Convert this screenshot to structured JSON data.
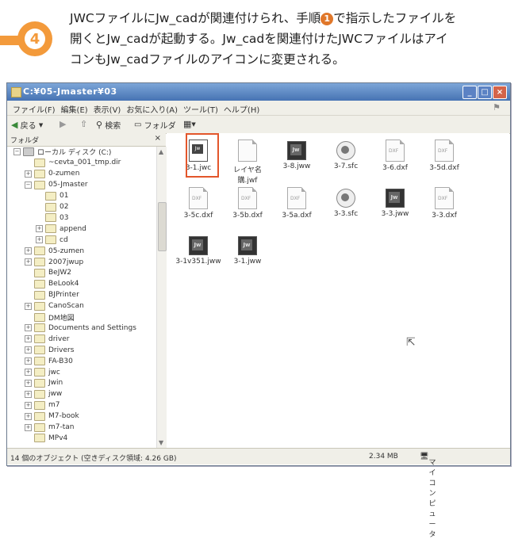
{
  "step": {
    "number": "4"
  },
  "caption": {
    "line1_a": "JWCファイルにJw_cadが関連付けられ、手順",
    "circled": "1",
    "line1_b": "で指示したファイルを",
    "line2": "開くとJw_cadが起動する。Jw_cadを関連付けたJWCファイルはアイ",
    "line3": "コンもJw_cadファイルのアイコンに変更される。"
  },
  "window": {
    "title": "C:¥05-Jmaster¥03",
    "menu": [
      "ファイル(F)",
      "編集(E)",
      "表示(V)",
      "お気に入り(A)",
      "ツール(T)",
      "ヘルプ(H)"
    ],
    "toolbar": {
      "back": "戻る",
      "search": "検索",
      "folders": "フォルダ"
    },
    "folder_pane_title": "フォルダ",
    "tree": [
      {
        "label": "ローカル ディスク (C:)",
        "indent": 0,
        "pm": "−"
      },
      {
        "label": "~cevta_001_tmp.dir",
        "indent": 1,
        "pm": ""
      },
      {
        "label": "0-zumen",
        "indent": 1,
        "pm": "+"
      },
      {
        "label": "05-Jmaster",
        "indent": 1,
        "pm": "−"
      },
      {
        "label": "01",
        "indent": 2,
        "pm": ""
      },
      {
        "label": "02",
        "indent": 2,
        "pm": ""
      },
      {
        "label": "03",
        "indent": 2,
        "pm": ""
      },
      {
        "label": "append",
        "indent": 2,
        "pm": "+"
      },
      {
        "label": "cd",
        "indent": 2,
        "pm": "+"
      },
      {
        "label": "05-zumen",
        "indent": 1,
        "pm": "+"
      },
      {
        "label": "2007jwup",
        "indent": 1,
        "pm": "+"
      },
      {
        "label": "BeJW2",
        "indent": 1,
        "pm": ""
      },
      {
        "label": "BeLook4",
        "indent": 1,
        "pm": ""
      },
      {
        "label": "BJPrinter",
        "indent": 1,
        "pm": ""
      },
      {
        "label": "CanoScan",
        "indent": 1,
        "pm": "+"
      },
      {
        "label": "DM地図",
        "indent": 1,
        "pm": ""
      },
      {
        "label": "Documents and Settings",
        "indent": 1,
        "pm": "+"
      },
      {
        "label": "driver",
        "indent": 1,
        "pm": "+"
      },
      {
        "label": "Drivers",
        "indent": 1,
        "pm": "+"
      },
      {
        "label": "FA-B30",
        "indent": 1,
        "pm": "+"
      },
      {
        "label": "jwc",
        "indent": 1,
        "pm": "+"
      },
      {
        "label": "Jwin",
        "indent": 1,
        "pm": "+"
      },
      {
        "label": "jww",
        "indent": 1,
        "pm": "+"
      },
      {
        "label": "m7",
        "indent": 1,
        "pm": "+"
      },
      {
        "label": "M7-book",
        "indent": 1,
        "pm": "+"
      },
      {
        "label": "m7-tan",
        "indent": 1,
        "pm": "+"
      },
      {
        "label": "MPv4",
        "indent": 1,
        "pm": ""
      }
    ],
    "files": [
      {
        "name": "3-1.jwc",
        "type": "jwc"
      },
      {
        "name": "レイヤ名購.jwf",
        "type": "doc",
        "lbl": ""
      },
      {
        "name": "3-8.jww",
        "type": "jw"
      },
      {
        "name": "3-7.sfc",
        "type": "sfc"
      },
      {
        "name": "3-6.dxf",
        "type": "doc",
        "lbl": "DXF"
      },
      {
        "name": "3-5d.dxf",
        "type": "doc",
        "lbl": "DXF"
      },
      {
        "name": "3-5c.dxf",
        "type": "doc",
        "lbl": "DXF"
      },
      {
        "name": "3-5b.dxf",
        "type": "doc",
        "lbl": "DXF"
      },
      {
        "name": "3-5a.dxf",
        "type": "doc",
        "lbl": "DXF"
      },
      {
        "name": "3-3.sfc",
        "type": "sfc"
      },
      {
        "name": "3-3.jww",
        "type": "jw"
      },
      {
        "name": "3-3.dxf",
        "type": "doc",
        "lbl": "DXF"
      },
      {
        "name": "3-1v351.jww",
        "type": "jw"
      },
      {
        "name": "3-1.jww",
        "type": "jw"
      }
    ],
    "status": {
      "objects": "14 個のオブジェクト (空きディスク領域: 4.26 GB)",
      "size": "2.34 MB",
      "location": "マイ コンピュータ"
    }
  },
  "colors": {
    "accent": "#f39a3b",
    "highlight": "#e3562b"
  }
}
